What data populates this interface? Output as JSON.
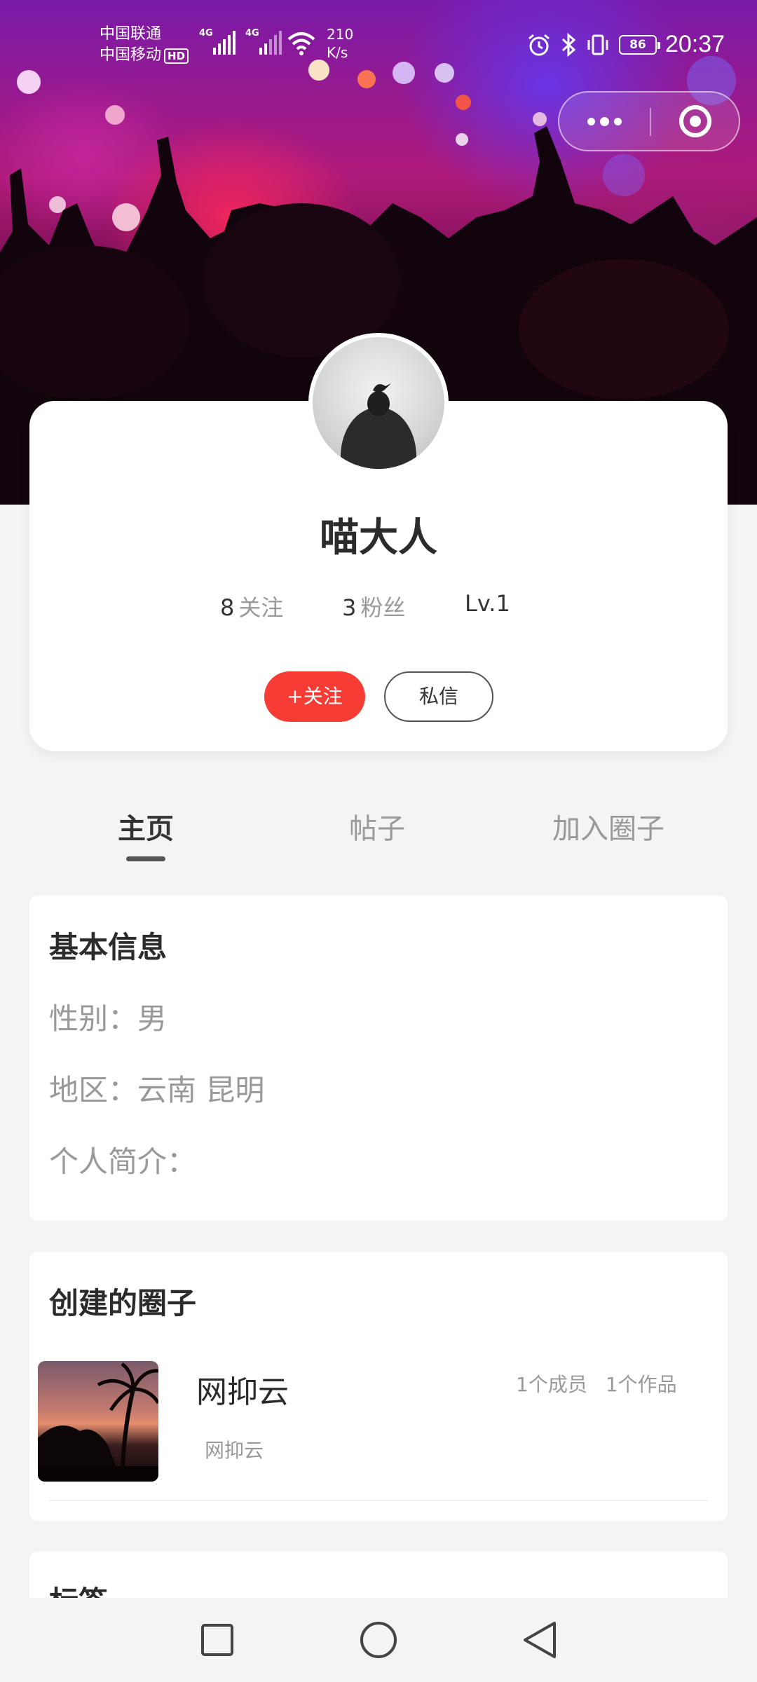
{
  "status_bar": {
    "carrier_1": "中国联通",
    "carrier_2": "中国移动",
    "hd_badge": "HD",
    "network_1": "4G",
    "network_2": "4G",
    "net_speed_value": "210",
    "net_speed_unit": "K/s",
    "battery": "86",
    "time": "20:37"
  },
  "profile": {
    "name": "喵大人",
    "following_count": "8",
    "following_label": "关注",
    "followers_count": "3",
    "followers_label": "粉丝",
    "level": "Lv.1",
    "follow_button": "+关注",
    "message_button": "私信"
  },
  "tabs": [
    {
      "label": "主页",
      "active": true
    },
    {
      "label": "帖子",
      "active": false
    },
    {
      "label": "加入圈子",
      "active": false
    }
  ],
  "basic_info": {
    "title": "基本信息",
    "gender": "性别：男",
    "region": "地区：云南 昆明",
    "bio": "个人简介："
  },
  "created_circles": {
    "title": "创建的圈子",
    "items": [
      {
        "name": "网抑云",
        "description": "网抑云",
        "members": "1个成员",
        "works": "1个作品"
      }
    ]
  },
  "tags": {
    "title": "标签"
  },
  "colors": {
    "accent": "#f73b35",
    "background": "#f4f4f4"
  }
}
